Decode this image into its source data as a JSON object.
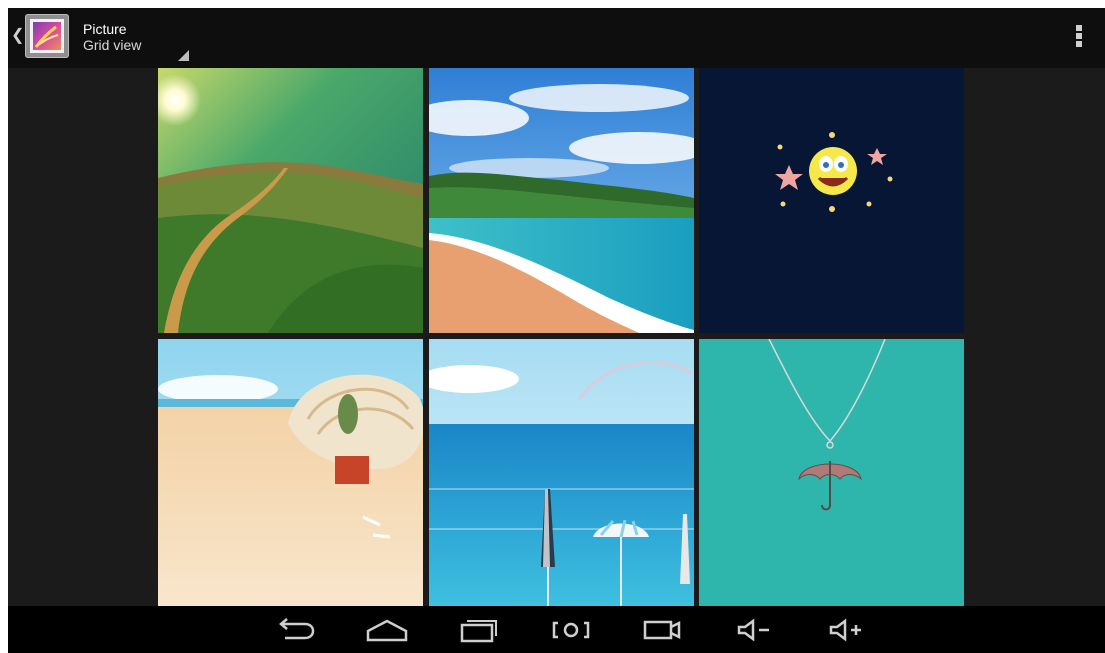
{
  "action_bar": {
    "title": "Picture",
    "subtitle": "Grid view",
    "app_icon": "gallery-app-icon",
    "up_icon": "chevron-left-icon",
    "menu_icon": "overflow-menu-icon"
  },
  "grid": {
    "photos": [
      {
        "name": "photo-meadow-path",
        "subject": "meadow-path"
      },
      {
        "name": "photo-tropical-beach",
        "subject": "tropical-beach"
      },
      {
        "name": "photo-sponge-stars",
        "subject": "sponge-stars"
      },
      {
        "name": "photo-seashell-beach",
        "subject": "seashell-beach"
      },
      {
        "name": "photo-sea-umbrellas",
        "subject": "sea-umbrellas"
      },
      {
        "name": "photo-umbrella-necklace",
        "subject": "umbrella-necklace"
      }
    ]
  },
  "nav_bar": {
    "buttons": [
      "back-icon",
      "home-icon",
      "recent-apps-icon",
      "screenshot-icon",
      "camera-icon",
      "volume-down-icon",
      "volume-up-icon"
    ]
  },
  "colors": {
    "action_bar_bg": "#0e0e0e",
    "grid_bg": "#1b1b1b",
    "nav_bar_bg": "#000000",
    "icon_color": "#cfcfcf"
  }
}
